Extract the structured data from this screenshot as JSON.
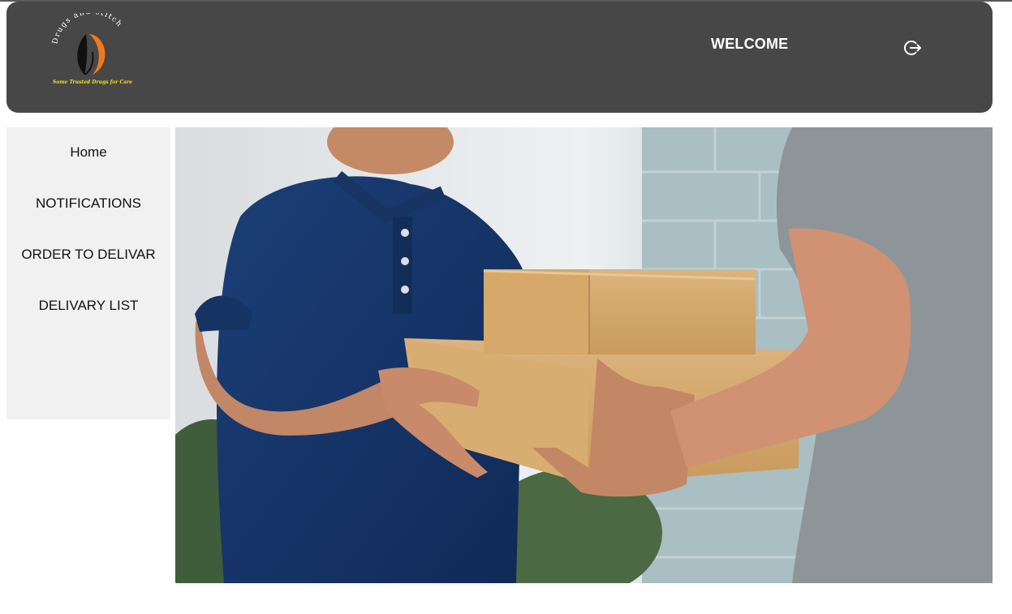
{
  "header": {
    "logo": {
      "arc_text": "Drugs and stitch",
      "tagline": "Some Trusted Drugs for Care",
      "colors": {
        "dark": "#111111",
        "accent": "#f07a1a",
        "tagline": "#f2e21a"
      }
    },
    "welcome_text": "WELCOME",
    "logout_icon": "logout-icon",
    "background": "#474747"
  },
  "sidebar": {
    "items": [
      {
        "label": "Home"
      },
      {
        "label": "NOTIFICATIONS"
      },
      {
        "label": "ORDER TO DELIVAR"
      },
      {
        "label": "DELIVARY LIST"
      }
    ],
    "background": "#f1f1f1"
  },
  "hero": {
    "subject": "delivery-handover-photo"
  }
}
